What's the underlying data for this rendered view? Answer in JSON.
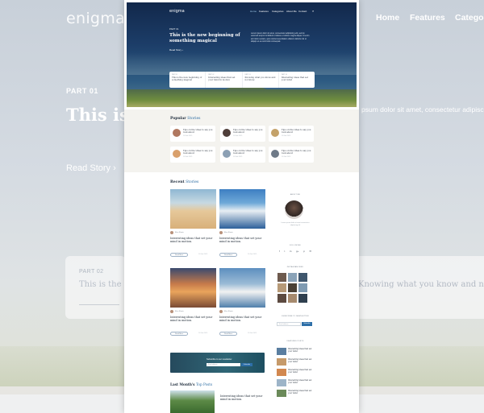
{
  "colors": {
    "accent": "#2e6fa8",
    "hero_dark": "#12284b",
    "page_bg": "#ffffff"
  },
  "background": {
    "logo": "enigma",
    "nav": [
      "Home",
      "Features",
      "Categori"
    ],
    "part": "PART 01",
    "title": "This is t somethi",
    "read_story": "Read Story ›",
    "lorem": "psum dolor sit amet, consectetur adipisci ipsum dolore magna aliqua. Ut enim ad minim ullamco laboris nisi ut aliquip ex ea commodo consequat. Duis aute irure dolor in",
    "card_part": "PART 02",
    "card_title": "This is the",
    "card2_title": "Knowing what you know and not know"
  },
  "hero": {
    "logo": "enigma",
    "nav": [
      "Home",
      "Features",
      "Categories",
      "About Me",
      "Contact"
    ],
    "search_icon": "search-icon",
    "part": "PART 01",
    "title": "This is the new beginning of something magical",
    "lorem": "Lorem ipsum dolor sit amet, consectetur adipisicing elit, sed do eiusmod tempor incididunt ut labore et dolore magna aliqua. Ut enim ad minim veniam, quis nostrud exercitation ullamco laboris nisi ut aliquip ex ea commodo consequat.",
    "read_story": "Read Story ›",
    "cards": [
      {
        "part": "PART 01",
        "title": "This is the new beginning of something magical"
      },
      {
        "part": "PART 02",
        "title": "Interesting ideas that set your mind in motion"
      },
      {
        "part": "PART 03",
        "title": "Knowing what you know and not know"
      },
      {
        "part": "PART 04",
        "title": "Interesting ideas that set your mind"
      }
    ]
  },
  "popular": {
    "title": "Popular",
    "title_hl": "Stories",
    "items": [
      {
        "title": "Tips on the vibes to say you look about",
        "date": "10 Feb 2019",
        "color": "#b07860"
      },
      {
        "title": "Tips on the vibes to say you look about",
        "date": "10 Feb 2019",
        "color": "#4f3e3a"
      },
      {
        "title": "Tips on the vibes to say you look about",
        "date": "10 Feb 2019",
        "color": "#c4a26a"
      },
      {
        "title": "Tips on the vibes to say you look about",
        "date": "10 Feb 2019",
        "color": "#d9a06c"
      },
      {
        "title": "Tips on the vibes to say you look about",
        "date": "10 Feb 2019",
        "color": "#8ca0b4"
      },
      {
        "title": "Tips on the vibes to say you look about",
        "date": "10 Feb 2019",
        "color": "#6f7a88"
      }
    ]
  },
  "recent": {
    "title": "Recent",
    "title_hl": "Stories",
    "posts": [
      {
        "author": "Eliza Shorts",
        "title": "Interesting ideas that set your mind in motion.",
        "btn": "Read More",
        "date": "10 Feb 2019"
      },
      {
        "author": "Eliza Shorts",
        "title": "Interesting ideas that set your mind in motion.",
        "btn": "Read More",
        "date": "10 Feb 2019"
      },
      {
        "author": "Eliza Shorts",
        "title": "Interesting ideas that set your mind in motion.",
        "btn": "Read More",
        "date": "10 Feb 2019"
      },
      {
        "author": "Eliza Shorts",
        "title": "Interesting ideas that set your mind in motion.",
        "btn": "Read More",
        "date": "10 Feb 2019"
      }
    ]
  },
  "sidebar": {
    "about": "ABOUT ME",
    "about_text": "Lorem ipsum dolor sit amet consectetur adipisicing elit",
    "follow": "FOLLOW ME",
    "social": [
      "f",
      "t",
      "in",
      "g+",
      "p",
      "✉"
    ],
    "instagram": "INSTAGRAM FEED",
    "subscribe": "SUBSCRIBE TO NEWSLETTER",
    "email_placeholder": "Email address",
    "subscribe_btn": "Subscribe",
    "featured": "FEATURED POSTS",
    "featured_posts": [
      "Interesting ideas that set your mind",
      "Interesting ideas that set your mind",
      "Interesting ideas that set your mind",
      "Interesting ideas that set your mind",
      "Interesting ideas that set your mind"
    ]
  },
  "banner": {
    "text": "Subscribe to our newsletter",
    "placeholder": "Email address",
    "btn": "Subscribe"
  },
  "last_month": {
    "title": "Last Month's",
    "title_hl": "Top Posts",
    "post_title": "Interesting ideas that set your mind in motion."
  }
}
